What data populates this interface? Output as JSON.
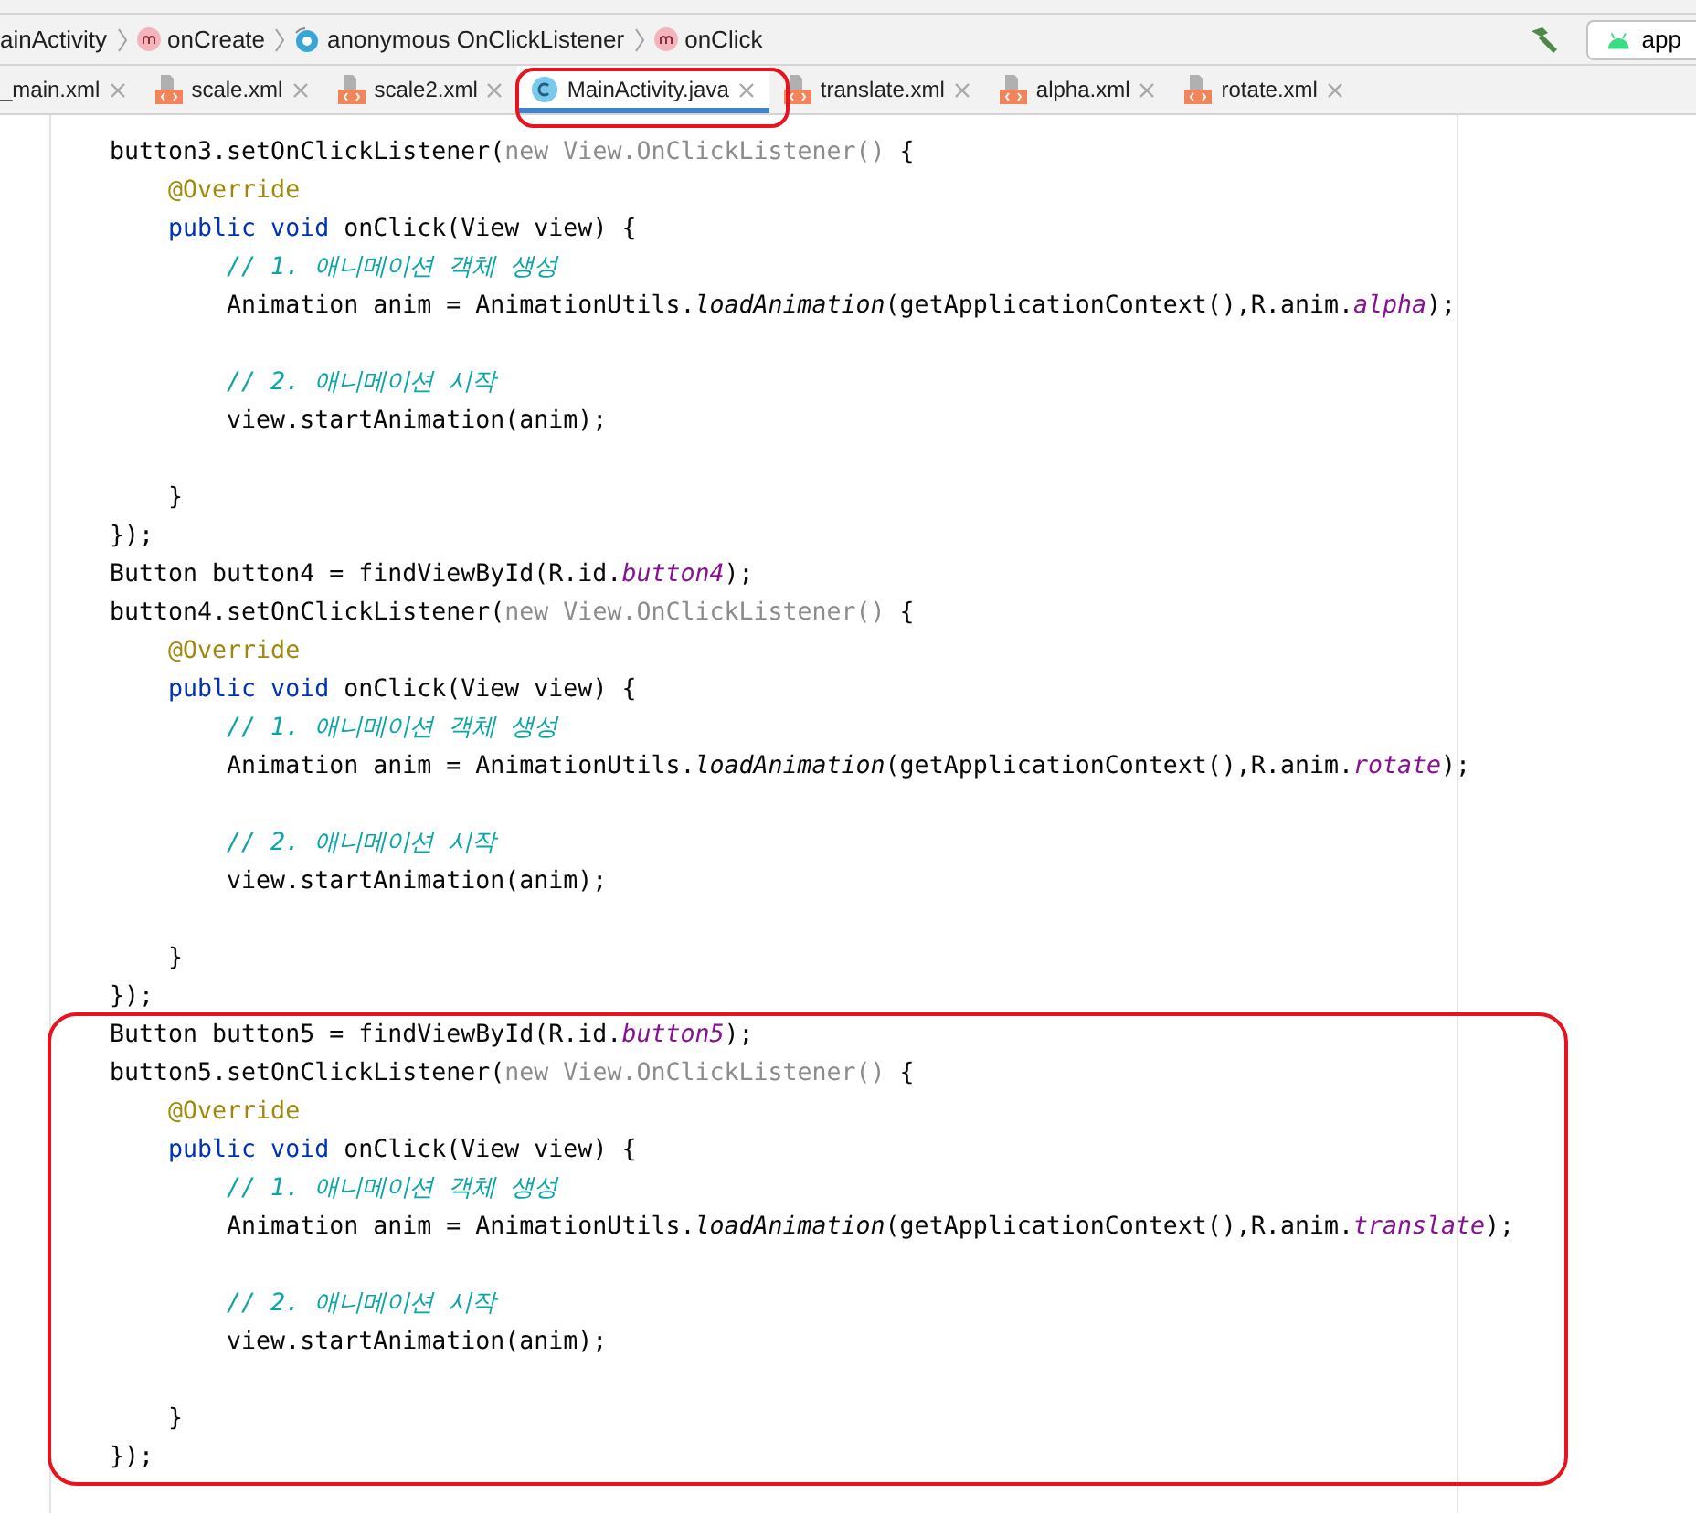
{
  "breadcrumbs": [
    {
      "label": "ainActivity",
      "kind": "plain"
    },
    {
      "label": "onCreate",
      "kind": "method"
    },
    {
      "label": "anonymous OnClickListener",
      "kind": "anonymous"
    },
    {
      "label": "onClick",
      "kind": "method"
    }
  ],
  "run_config": {
    "label": "app"
  },
  "tabs": [
    {
      "label": "_main.xml",
      "kind": "cut",
      "selected": false
    },
    {
      "label": "scale.xml",
      "kind": "xml",
      "selected": false
    },
    {
      "label": "scale2.xml",
      "kind": "xml",
      "selected": false
    },
    {
      "label": "MainActivity.java",
      "kind": "class",
      "selected": true
    },
    {
      "label": "translate.xml",
      "kind": "xml",
      "selected": false
    },
    {
      "label": "alpha.xml",
      "kind": "xml",
      "selected": false
    },
    {
      "label": "rotate.xml",
      "kind": "xml",
      "selected": false
    }
  ],
  "code_lines": [
    {
      "kind": "code",
      "segments": [
        {
          "text": "button3.setOnClickListener(",
          "kind": "plain"
        },
        {
          "text": "new View.OnClickListener()",
          "kind": "hint"
        },
        {
          "text": " {",
          "kind": "plain"
        }
      ]
    },
    {
      "kind": "code",
      "segments": [
        {
          "text": "    @Override",
          "kind": "annotation"
        }
      ]
    },
    {
      "kind": "code",
      "segments": [
        {
          "text": "    public void",
          "kind": "keyword"
        },
        {
          "text": " onClick(View view) {",
          "kind": "plain"
        }
      ]
    },
    {
      "kind": "code",
      "segments": [
        {
          "text": "        // 1. 애니메이션 객체 생성",
          "kind": "comment"
        }
      ]
    },
    {
      "kind": "code",
      "segments": [
        {
          "text": "        Animation anim = AnimationUtils.",
          "kind": "plain"
        },
        {
          "text": "loadAnimation",
          "kind": "method"
        },
        {
          "text": "(getApplicationContext(),R.anim.",
          "kind": "plain"
        },
        {
          "text": "alpha",
          "kind": "field"
        },
        {
          "text": ");",
          "kind": "plain"
        }
      ]
    },
    {
      "kind": "blank"
    },
    {
      "kind": "code",
      "segments": [
        {
          "text": "        // 2. 애니메이션 시작",
          "kind": "comment"
        }
      ]
    },
    {
      "kind": "code",
      "segments": [
        {
          "text": "        view.startAnimation(anim);",
          "kind": "plain"
        }
      ]
    },
    {
      "kind": "blank"
    },
    {
      "kind": "code",
      "segments": [
        {
          "text": "    }",
          "kind": "plain"
        }
      ]
    },
    {
      "kind": "code",
      "segments": [
        {
          "text": "});",
          "kind": "plain"
        }
      ]
    },
    {
      "kind": "code",
      "segments": [
        {
          "text": "Button button4 = findViewById(R.id.",
          "kind": "plain"
        },
        {
          "text": "button4",
          "kind": "field"
        },
        {
          "text": ");",
          "kind": "plain"
        }
      ]
    },
    {
      "kind": "code",
      "segments": [
        {
          "text": "button4.setOnClickListener(",
          "kind": "plain"
        },
        {
          "text": "new View.OnClickListener()",
          "kind": "hint"
        },
        {
          "text": " {",
          "kind": "plain"
        }
      ]
    },
    {
      "kind": "code",
      "segments": [
        {
          "text": "    @Override",
          "kind": "annotation"
        }
      ]
    },
    {
      "kind": "code",
      "segments": [
        {
          "text": "    public void",
          "kind": "keyword"
        },
        {
          "text": " onClick(View view) {",
          "kind": "plain"
        }
      ]
    },
    {
      "kind": "code",
      "segments": [
        {
          "text": "        // 1. 애니메이션 객체 생성",
          "kind": "comment"
        }
      ]
    },
    {
      "kind": "code",
      "segments": [
        {
          "text": "        Animation anim = AnimationUtils.",
          "kind": "plain"
        },
        {
          "text": "loadAnimation",
          "kind": "method"
        },
        {
          "text": "(getApplicationContext(),R.anim.",
          "kind": "plain"
        },
        {
          "text": "rotate",
          "kind": "field"
        },
        {
          "text": ");",
          "kind": "plain"
        }
      ]
    },
    {
      "kind": "blank"
    },
    {
      "kind": "code",
      "segments": [
        {
          "text": "        // 2. 애니메이션 시작",
          "kind": "comment"
        }
      ]
    },
    {
      "kind": "code",
      "segments": [
        {
          "text": "        view.startAnimation(anim);",
          "kind": "plain"
        }
      ]
    },
    {
      "kind": "blank"
    },
    {
      "kind": "code",
      "segments": [
        {
          "text": "    }",
          "kind": "plain"
        }
      ]
    },
    {
      "kind": "code",
      "segments": [
        {
          "text": "});",
          "kind": "plain"
        }
      ]
    },
    {
      "kind": "code",
      "segments": [
        {
          "text": "Button button5 = findViewById(R.id.",
          "kind": "plain"
        },
        {
          "text": "button5",
          "kind": "field"
        },
        {
          "text": ");",
          "kind": "plain"
        }
      ]
    },
    {
      "kind": "code",
      "segments": [
        {
          "text": "button5.setOnClickListener(",
          "kind": "plain"
        },
        {
          "text": "new View.OnClickListener()",
          "kind": "hint"
        },
        {
          "text": " {",
          "kind": "plain"
        }
      ]
    },
    {
      "kind": "code",
      "segments": [
        {
          "text": "    @Override",
          "kind": "annotation"
        }
      ]
    },
    {
      "kind": "code",
      "segments": [
        {
          "text": "    public void",
          "kind": "keyword"
        },
        {
          "text": " onClick(View view) {",
          "kind": "plain"
        }
      ]
    },
    {
      "kind": "code",
      "segments": [
        {
          "text": "        // 1. 애니메이션 객체 생성",
          "kind": "comment"
        }
      ]
    },
    {
      "kind": "code",
      "segments": [
        {
          "text": "        Animation anim = AnimationUtils.",
          "kind": "plain"
        },
        {
          "text": "loadAnimation",
          "kind": "method"
        },
        {
          "text": "(getApplicationContext(),R.anim.",
          "kind": "plain"
        },
        {
          "text": "translate",
          "kind": "field"
        },
        {
          "text": ");",
          "kind": "plain"
        }
      ]
    },
    {
      "kind": "blank"
    },
    {
      "kind": "code",
      "segments": [
        {
          "text": "        // 2. 애니메이션 시작",
          "kind": "comment"
        }
      ]
    },
    {
      "kind": "code",
      "segments": [
        {
          "text": "        view.startAnimation(anim);",
          "kind": "plain"
        }
      ]
    },
    {
      "kind": "blank"
    },
    {
      "kind": "code",
      "segments": [
        {
          "text": "    }",
          "kind": "plain"
        }
      ]
    },
    {
      "kind": "code",
      "segments": [
        {
          "text": "});",
          "kind": "plain"
        }
      ]
    }
  ]
}
